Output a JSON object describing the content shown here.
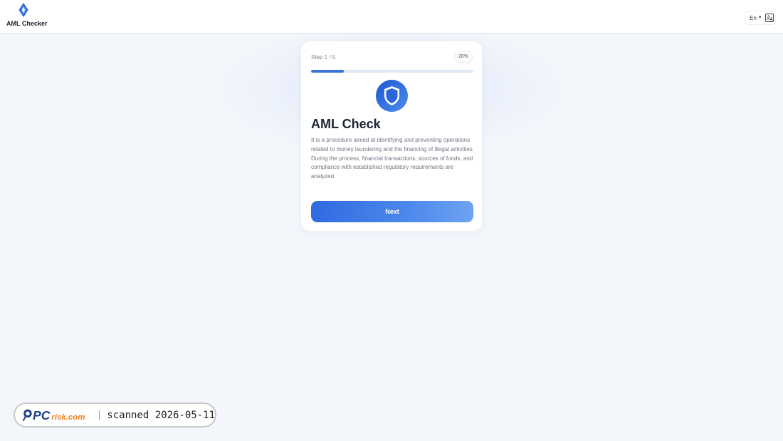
{
  "header": {
    "brand": "AML Checker",
    "language": "En"
  },
  "card": {
    "step_label": "Step 1 / 5",
    "percent_label": "20%",
    "progress": 0.2,
    "title": "AML Check",
    "description": "It is a procedure aimed at identifying and preventing operations related to money laundering and the financing of illegal activities. During the process, financial transactions, sources of funds, and compliance with established regulatory requirements are analyzed.",
    "next_label": "Next"
  },
  "watermark": {
    "logo": "PCrisk.com",
    "text": "scanned 2026-05-11"
  },
  "colors": {
    "accent": "#2f6be0",
    "background": "#f3f6fb"
  },
  "icons": {
    "logo": "blue-diamond-icon",
    "language": "translate-icon",
    "shield": "shield-icon"
  }
}
